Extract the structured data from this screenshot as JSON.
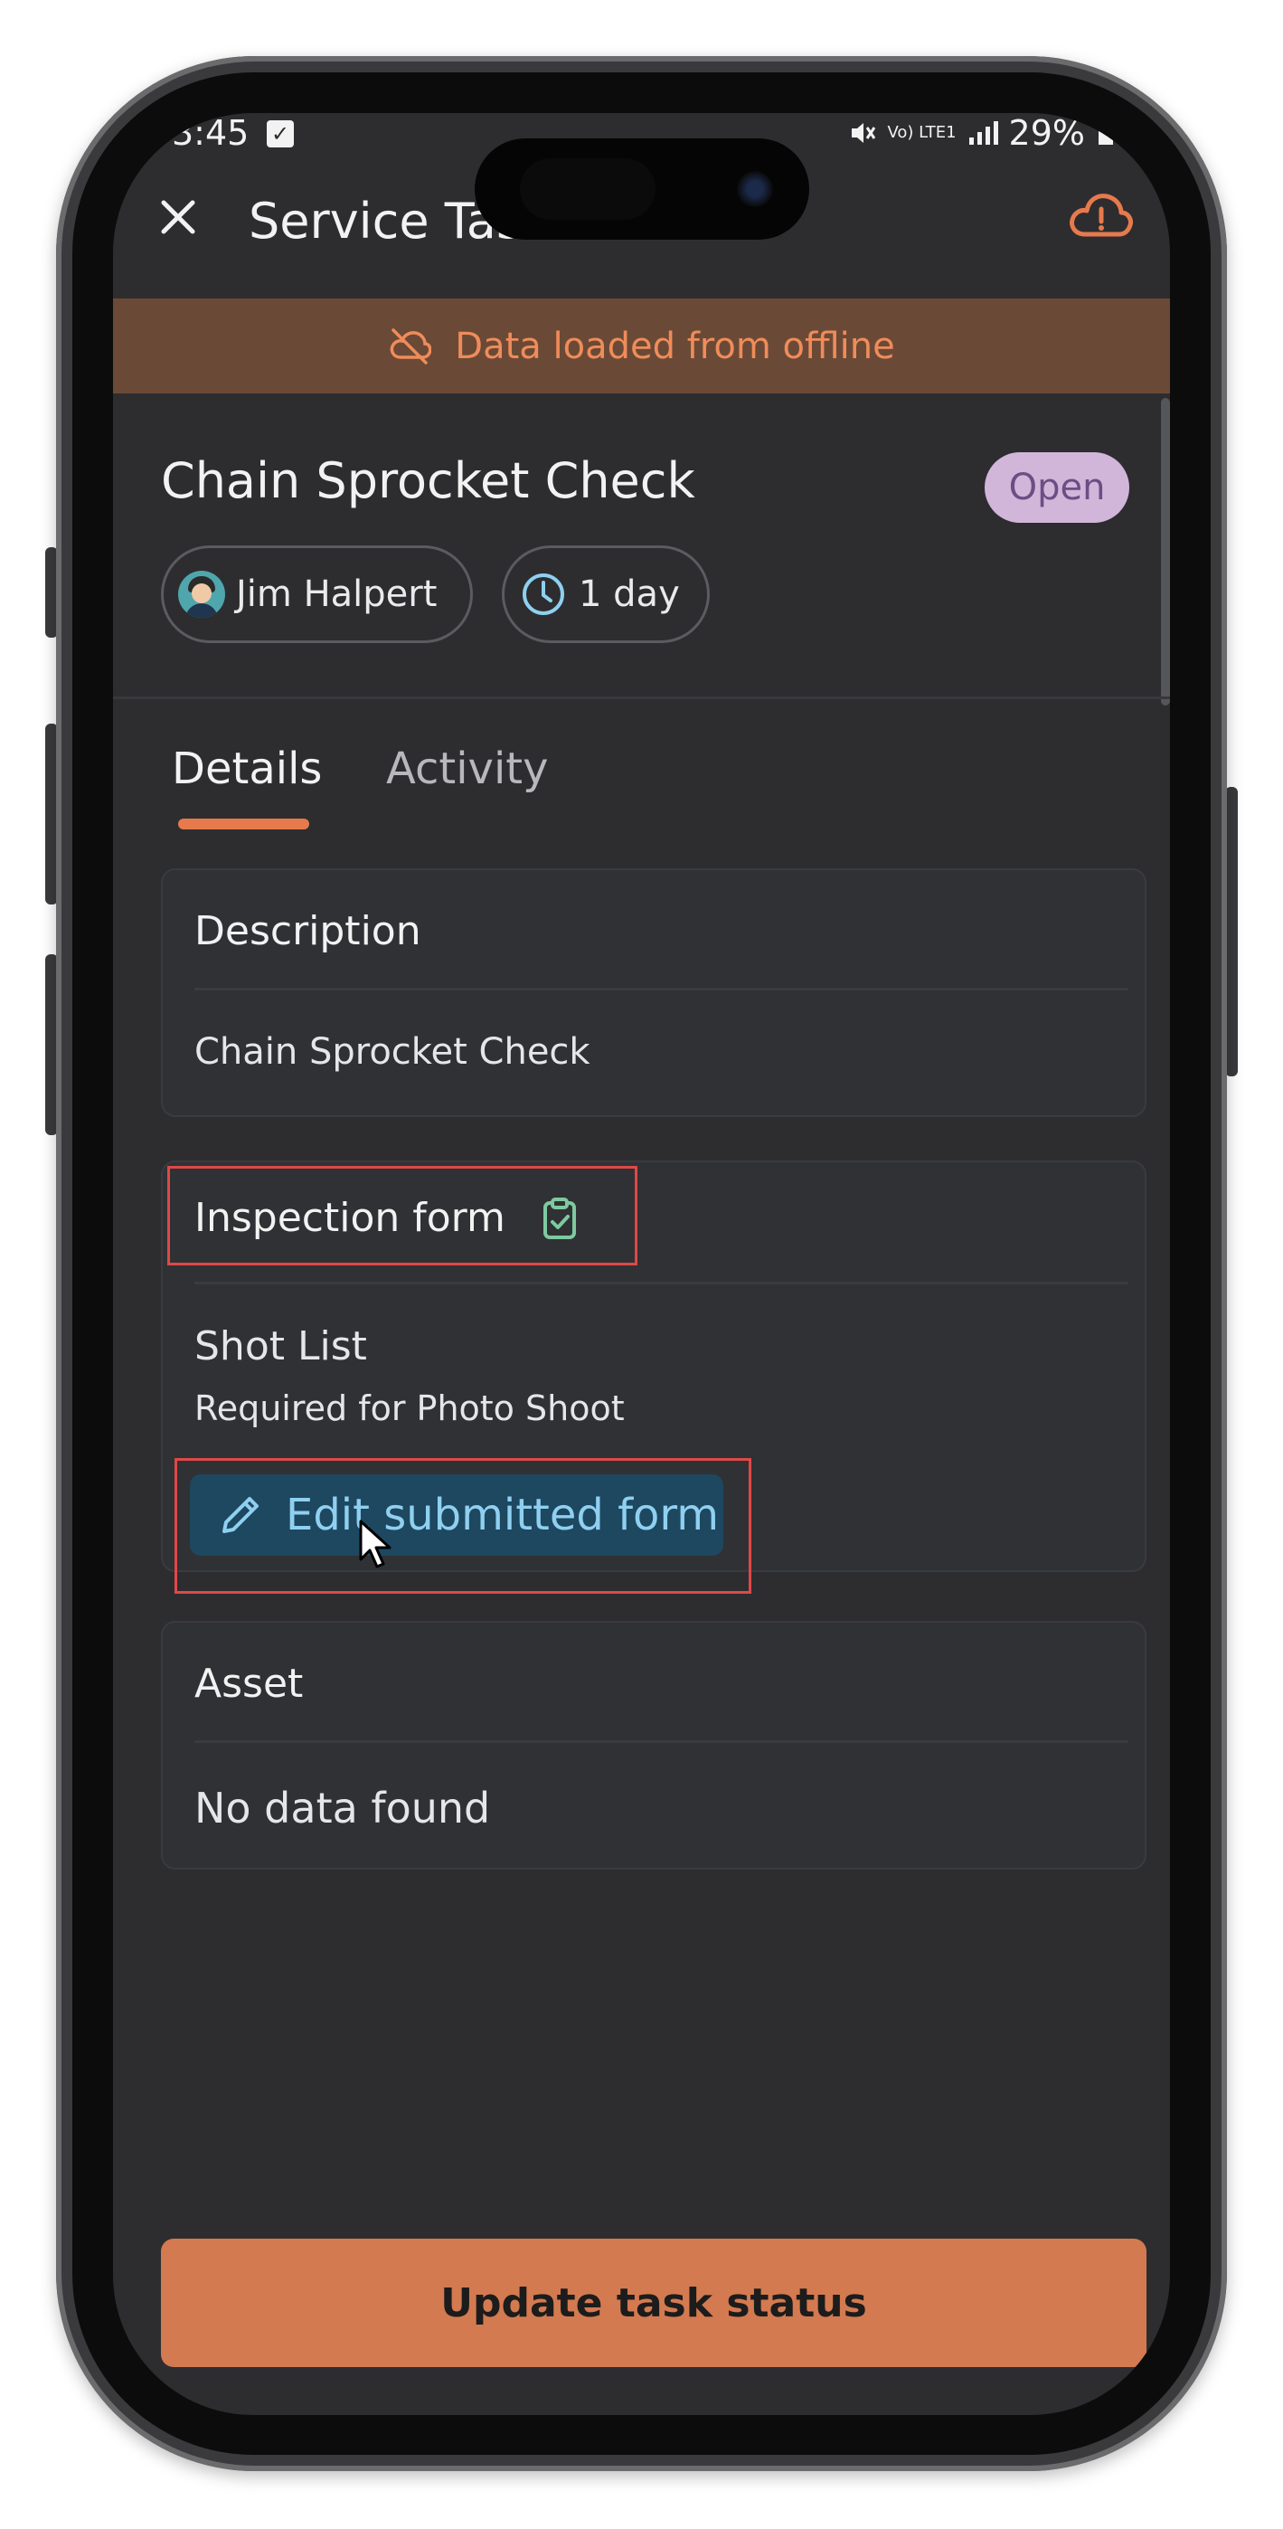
{
  "status_bar": {
    "time": "3:45",
    "network_small": "Vo) LTE1",
    "battery": "29%"
  },
  "header": {
    "title": "Service Task"
  },
  "offline_banner": {
    "text": "Data loaded from offline"
  },
  "task": {
    "title": "Chain Sprocket Check",
    "status": "Open",
    "assignee": "Jim Halpert",
    "duration": "1 day"
  },
  "tabs": [
    {
      "label": "Details",
      "active": true
    },
    {
      "label": "Activity",
      "active": false
    }
  ],
  "description": {
    "title": "Description",
    "text": "Chain Sprocket Check"
  },
  "inspection_form": {
    "title": "Inspection form",
    "form_name": "Shot List",
    "form_subtitle": "Required for Photo Shoot",
    "edit_label": "Edit submitted form"
  },
  "asset": {
    "title": "Asset",
    "empty_text": "No data found"
  },
  "footer": {
    "update_label": "Update task status"
  },
  "colors": {
    "accent": "#e67a4c",
    "offline_banner_bg": "#6a4a36",
    "status_badge_bg": "#d2b6da",
    "edit_button_bg": "#1e4760",
    "highlight_border": "#e04848"
  },
  "icons": {
    "close": "close-icon",
    "cloud_alert": "cloud-alert-icon",
    "cloud_off": "cloud-off-icon",
    "clock": "clock-icon",
    "clipboard_check": "clipboard-check-icon",
    "pencil": "pencil-icon",
    "cursor": "mouse-cursor-icon"
  }
}
